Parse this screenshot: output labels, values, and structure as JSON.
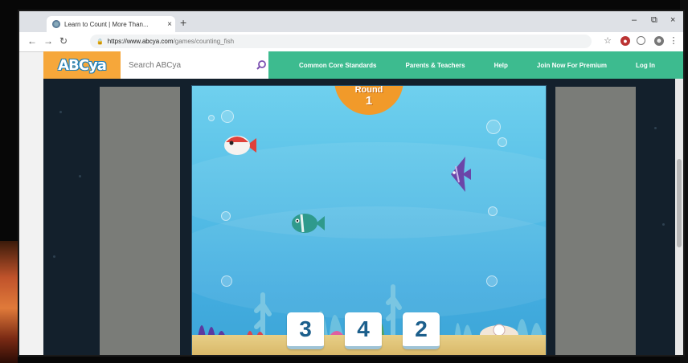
{
  "browser": {
    "tab_title": "Learn to Count | More Than...",
    "tab_close": "×",
    "new_tab": "+",
    "url_host": "https://www.abcya.com",
    "url_path": "/games/counting_fish",
    "window_controls": [
      "–",
      "⧉",
      "×"
    ]
  },
  "site": {
    "logo": "ABCya",
    "search_placeholder": "Search ABCya",
    "nav": [
      "Common Core Standards",
      "Parents & Teachers",
      "Help",
      "Join Now For Premium",
      "Log In"
    ]
  },
  "game": {
    "title": "counting_fish",
    "round_label": "Round",
    "round_number": "1",
    "answer_choices": [
      "3",
      "4",
      "2"
    ],
    "fish": [
      {
        "kind": "red-white-fish",
        "color": "#e0413a"
      },
      {
        "kind": "purple-angelfish",
        "color": "#6b45a8"
      },
      {
        "kind": "teal-fish",
        "color": "#2f9a8c"
      }
    ]
  },
  "colors": {
    "site_green": "#3dbb8f",
    "logo_orange": "#f6a73a",
    "water": "#54bde6",
    "round_badge": "#f19a2a",
    "choice_text": "#1c5f8c"
  }
}
